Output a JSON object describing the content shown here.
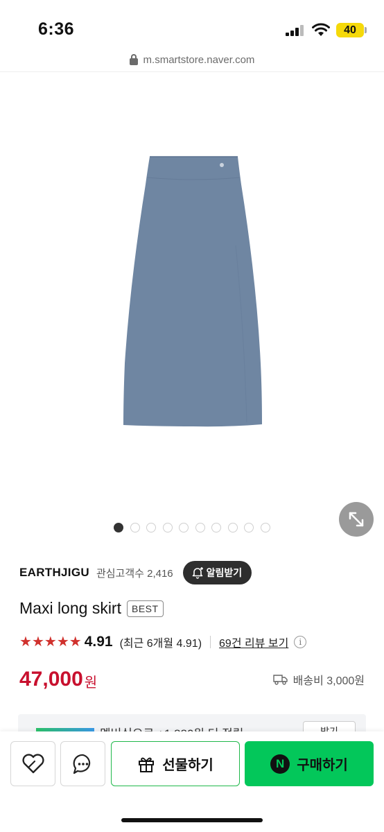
{
  "status_bar": {
    "time": "6:36",
    "battery": "40",
    "battery_color": "#f5d90a"
  },
  "browser": {
    "url": "m.smartstore.naver.com",
    "lock_icon": "lock-icon"
  },
  "gallery": {
    "image_count": 10,
    "active_index": 0,
    "expand_icon": "expand-arrows-icon",
    "skirt_color": "#6f86a2"
  },
  "store": {
    "brand": "EARTHJIGU",
    "followers_label": "관심고객수 2,416",
    "alert_label": "알림받기",
    "alert_icon": "bell-plus-icon"
  },
  "product": {
    "title": "Maxi long skirt",
    "badge": "BEST"
  },
  "rating": {
    "stars": 5,
    "value": "4.91",
    "recent": "(최근 6개월 4.91)",
    "review_link": "69건 리뷰 보기",
    "info_icon": "info-icon",
    "star_color": "#d0312d"
  },
  "price": {
    "amount": "47,000",
    "unit": "원",
    "shipping": "배송비 3,000원",
    "shipping_icon": "truck-icon",
    "price_color": "#c8102e"
  },
  "coupon": {
    "text": "멤버십으로 +1,880원 더 적립",
    "button": "받기"
  },
  "bottom_bar": {
    "wishlist_icon": "heart-icon",
    "talk_icon": "chat-bubble-icon",
    "gift_label": "선물하기",
    "gift_icon": "gift-icon",
    "buy_label": "구매하기",
    "buy_logo": "N",
    "accent_color": "#03c75a"
  }
}
